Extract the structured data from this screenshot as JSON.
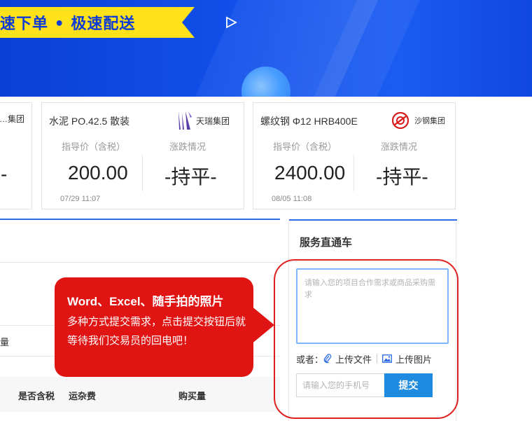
{
  "banner": {
    "slogan": "速下单 • 极速配送",
    "accent_color": "#ffe21a",
    "background_color": "#1150ea"
  },
  "cards": [
    {
      "brand_name": "…集团",
      "value_fragment": "-"
    },
    {
      "product": "水泥 PO.42.5 散装",
      "brand_name": "天瑞集团",
      "price_label": "指导价（含税）",
      "trend_label": "涨跌情况",
      "price": "200.00",
      "trend": "-持平-",
      "timestamp": "07/29 11:07",
      "logo_icon": "tianrui-logo-icon"
    },
    {
      "product": "螺纹钢 Φ12 HRB400E",
      "brand_name": "沙钢集团",
      "price_label": "指导价（含税）",
      "trend_label": "涨跌情况",
      "price": "2400.00",
      "trend": "-持平-",
      "timestamp": "08/05 11:08",
      "logo_icon": "shagang-logo-icon"
    }
  ],
  "table": {
    "partial_header": "量",
    "columns": [
      "是否含税",
      "运杂费",
      "购买量"
    ]
  },
  "service": {
    "title": "服务直通车",
    "textarea_placeholder": "请输入您的项目合作需求或商品采购需求",
    "or_label": "或者：",
    "upload_file": "上传文件",
    "upload_image": "上传图片",
    "phone_placeholder": "请输入您的手机号",
    "submit_label": "提交",
    "accent_color": "#1d8ce0"
  },
  "annotation": {
    "headline": "Word、Excel、随手拍的照片",
    "body": "多种方式提交需求，点击提交按钮后就等待我们交易员的回电吧！",
    "color": "#e11414"
  }
}
